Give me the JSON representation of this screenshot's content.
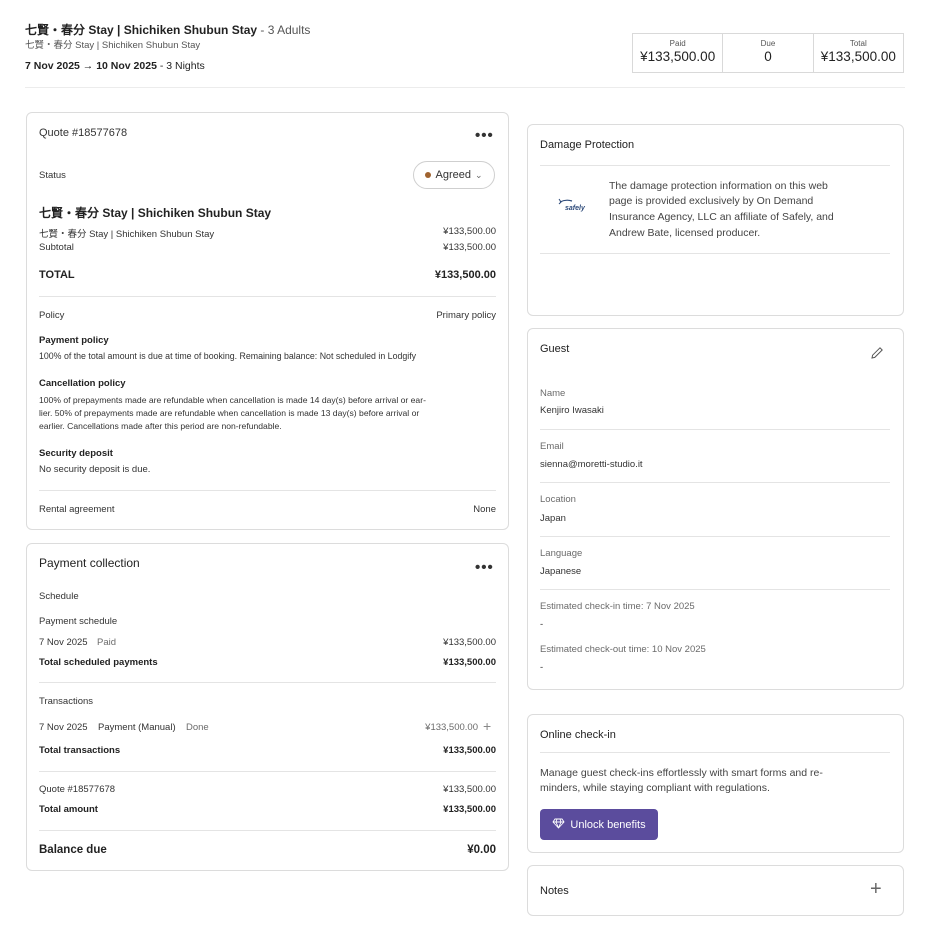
{
  "header": {
    "title": "七賢・春分 Stay | Shichiken Shubun Stay",
    "adults": " - 3 Adults",
    "subtitle": "七賢・春分 Stay | Shichiken Shubun Stay",
    "dates": "7 Nov 2025 → 10 Nov 2025",
    "nights": " - 3 Nights"
  },
  "summary": {
    "paid_label": "Paid",
    "paid_value": "¥133,500.00",
    "due_label": "Due",
    "due_value": "0",
    "total_label": "Total",
    "total_value": "¥133,500.00"
  },
  "quote": {
    "title": "Quote #18577678",
    "status_label": "Status",
    "status_value": "Agreed",
    "property_title": "七賢・春分 Stay | Shichiken Shubun Stay",
    "line_item": "七賢・春分 Stay | Shichiken Shubun Stay",
    "line_item_amount": "¥133,500.00",
    "subtotal_label": "Subtotal",
    "subtotal_amount": "¥133,500.00",
    "total_label": "TOTAL",
    "total_amount": "¥133,500.00",
    "policy_label": "Policy",
    "policy_value": "Primary policy",
    "payment_policy_title": "Payment policy",
    "payment_policy_text": "100% of the total amount is due at time of booking. Remaining balance: Not scheduled in Lodgify",
    "cancellation_title": "Cancellation policy",
    "cancellation_line1": "100% of prepayments made are refundable when cancellation is made 14 day(s) before arrival or ear-",
    "cancellation_line2": "lier. 50% of prepayments made are refundable when cancellation is made 13 day(s) before arrival or",
    "cancellation_line3": "earlier. Cancellations made after this period are non-refundable.",
    "deposit_title": "Security deposit",
    "deposit_text": "No security deposit is due.",
    "rental_label": "Rental agreement",
    "rental_value": "None"
  },
  "payment": {
    "title": "Payment collection",
    "schedule_label": "Schedule",
    "payment_schedule_label": "Payment schedule",
    "schedule_date": "7 Nov 2025",
    "schedule_status": "Paid",
    "schedule_amount": "¥133,500.00",
    "total_scheduled_label": "Total scheduled payments",
    "total_scheduled_amount": "¥133,500.00",
    "transactions_label": "Transactions",
    "tx_date": "7 Nov 2025",
    "tx_type": "Payment (Manual)",
    "tx_status": "Done",
    "tx_amount": "¥133,500.00",
    "total_tx_label": "Total transactions",
    "total_tx_amount": "¥133,500.00",
    "quote_ref": "Quote #18577678",
    "quote_ref_amount": "¥133,500.00",
    "total_amount_label": "Total amount",
    "total_amount_value": "¥133,500.00",
    "balance_label": "Balance due",
    "balance_value": "¥0.00"
  },
  "damage": {
    "title": "Damage Protection",
    "logo_text": "safely",
    "line1": "The damage protection information on this web",
    "line2": "page is provided exclusively by On Demand",
    "line3": "Insurance Agency, LLC an affiliate of Safely, and",
    "line4": "Andrew Bate, licensed producer."
  },
  "guest": {
    "title": "Guest",
    "name_label": "Name",
    "name_value": "Kenjiro Iwasaki",
    "email_label": "Email",
    "email_value": "sienna@moretti-studio.it",
    "location_label": "Location",
    "location_value": "Japan",
    "language_label": "Language",
    "language_value": "Japanese",
    "checkin_label": "Estimated check-in time: 7 Nov 2025",
    "checkin_value": "-",
    "checkout_label": "Estimated check-out time: 10 Nov 2025",
    "checkout_value": "-"
  },
  "checkin": {
    "title": "Online check-in",
    "line1": "Manage guest check-ins effortlessly with smart forms and re-",
    "line2": "minders, while staying compliant with regulations.",
    "button": "Unlock benefits"
  },
  "notes": {
    "title": "Notes",
    "add_symbol": "+"
  },
  "icons": {
    "more": "more-horizontal-icon",
    "edit": "pencil-icon",
    "add": "plus-icon",
    "gem": "diamond-icon"
  },
  "colors": {
    "accent_button": "#5b4c9d",
    "status_dot": "#a0632f"
  }
}
